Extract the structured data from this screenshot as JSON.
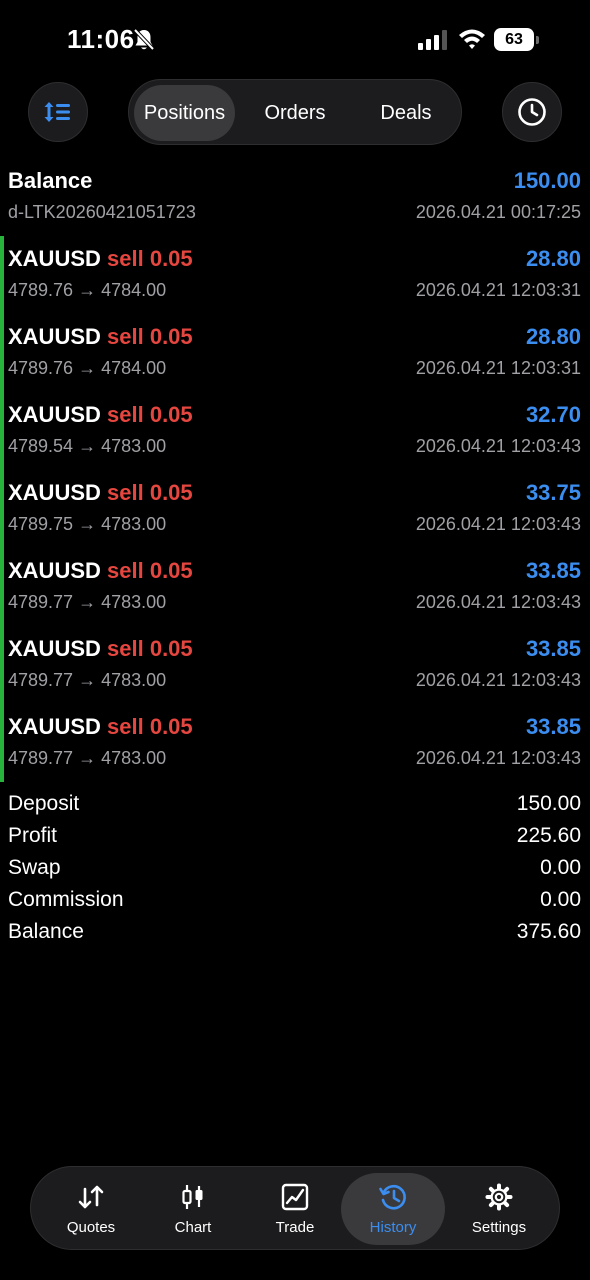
{
  "status_bar": {
    "time": "11:06",
    "battery": "63"
  },
  "segments": {
    "positions": "Positions",
    "orders": "Orders",
    "deals": "Deals"
  },
  "balance_entry": {
    "title": "Balance",
    "value": "150.00",
    "id": "d-LTK20260421051723",
    "time": "2026.04.21 00:17:25"
  },
  "deals": [
    {
      "symbol": "XAUUSD",
      "side": "sell 0.05",
      "profit": "28.80",
      "prices": "4789.76 → 4784.00",
      "time": "2026.04.21 12:03:31"
    },
    {
      "symbol": "XAUUSD",
      "side": "sell 0.05",
      "profit": "28.80",
      "prices": "4789.76 → 4784.00",
      "time": "2026.04.21 12:03:31"
    },
    {
      "symbol": "XAUUSD",
      "side": "sell 0.05",
      "profit": "32.70",
      "prices": "4789.54 → 4783.00",
      "time": "2026.04.21 12:03:43"
    },
    {
      "symbol": "XAUUSD",
      "side": "sell 0.05",
      "profit": "33.75",
      "prices": "4789.75 → 4783.00",
      "time": "2026.04.21 12:03:43"
    },
    {
      "symbol": "XAUUSD",
      "side": "sell 0.05",
      "profit": "33.85",
      "prices": "4789.77 → 4783.00",
      "time": "2026.04.21 12:03:43"
    },
    {
      "symbol": "XAUUSD",
      "side": "sell 0.05",
      "profit": "33.85",
      "prices": "4789.77 → 4783.00",
      "time": "2026.04.21 12:03:43"
    },
    {
      "symbol": "XAUUSD",
      "side": "sell 0.05",
      "profit": "33.85",
      "prices": "4789.77 → 4783.00",
      "time": "2026.04.21 12:03:43"
    }
  ],
  "summary": {
    "deposit": {
      "label": "Deposit",
      "value": "150.00"
    },
    "profit": {
      "label": "Profit",
      "value": "225.60"
    },
    "swap": {
      "label": "Swap",
      "value": "0.00"
    },
    "commission": {
      "label": "Commission",
      "value": "0.00"
    },
    "balance": {
      "label": "Balance",
      "value": "375.60"
    }
  },
  "tabs": {
    "quotes": "Quotes",
    "chart": "Chart",
    "trade": "Trade",
    "history": "History",
    "settings": "Settings"
  },
  "colors": {
    "accent": "#3b8ef0",
    "sell": "#e5463f",
    "profit_bar": "#28b43c"
  },
  "icons": [
    "bell-slash-icon",
    "signal-icon",
    "wifi-icon",
    "battery-icon",
    "sort-icon",
    "clock-icon",
    "quotes-icon",
    "candlestick-icon",
    "trade-chart-icon",
    "history-icon",
    "gear-icon"
  ]
}
